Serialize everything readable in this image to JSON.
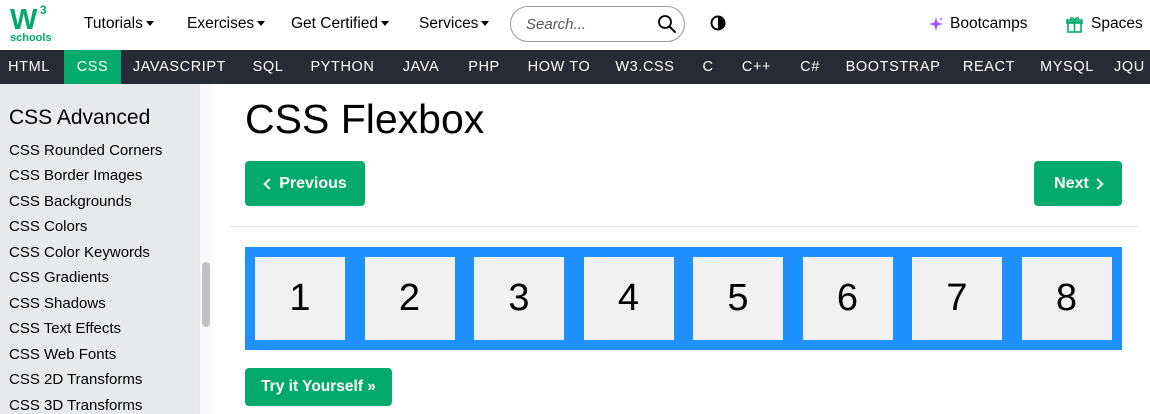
{
  "topbar": {
    "logo": {
      "mark": "W",
      "superscript": "3",
      "subtitle": "schools"
    },
    "nav": [
      {
        "label": "Tutorials"
      },
      {
        "label": "Exercises"
      },
      {
        "label": "Get Certified"
      },
      {
        "label": "Services"
      }
    ],
    "search_placeholder": "Search...",
    "bootcamps": "Bootcamps",
    "spaces": "Spaces",
    "accent": "#04AA6D",
    "bootcamps_icon_color": "#9B59FF"
  },
  "darknav": {
    "items": [
      "HTML",
      "CSS",
      "JAVASCRIPT",
      "SQL",
      "PYTHON",
      "JAVA",
      "PHP",
      "HOW TO",
      "W3.CSS",
      "C",
      "C++",
      "C#",
      "BOOTSTRAP",
      "REACT",
      "MYSQL",
      "JQU"
    ],
    "active": "CSS",
    "background": "#282A35"
  },
  "sidebar": {
    "heading": "CSS Advanced",
    "links": [
      "CSS Rounded Corners",
      "CSS Border Images",
      "CSS Backgrounds",
      "CSS Colors",
      "CSS Color Keywords",
      "CSS Gradients",
      "CSS Shadows",
      "CSS Text Effects",
      "CSS Web Fonts",
      "CSS 2D Transforms",
      "CSS 3D Transforms"
    ]
  },
  "main": {
    "title": "CSS Flexbox",
    "prev_label": "Previous",
    "next_label": "Next",
    "flex_items": [
      "1",
      "2",
      "3",
      "4",
      "5",
      "6",
      "7",
      "8"
    ],
    "flex_container_color": "#1E90FF",
    "flex_item_color": "#F1F1F1",
    "try_label": "Try it Yourself »"
  }
}
